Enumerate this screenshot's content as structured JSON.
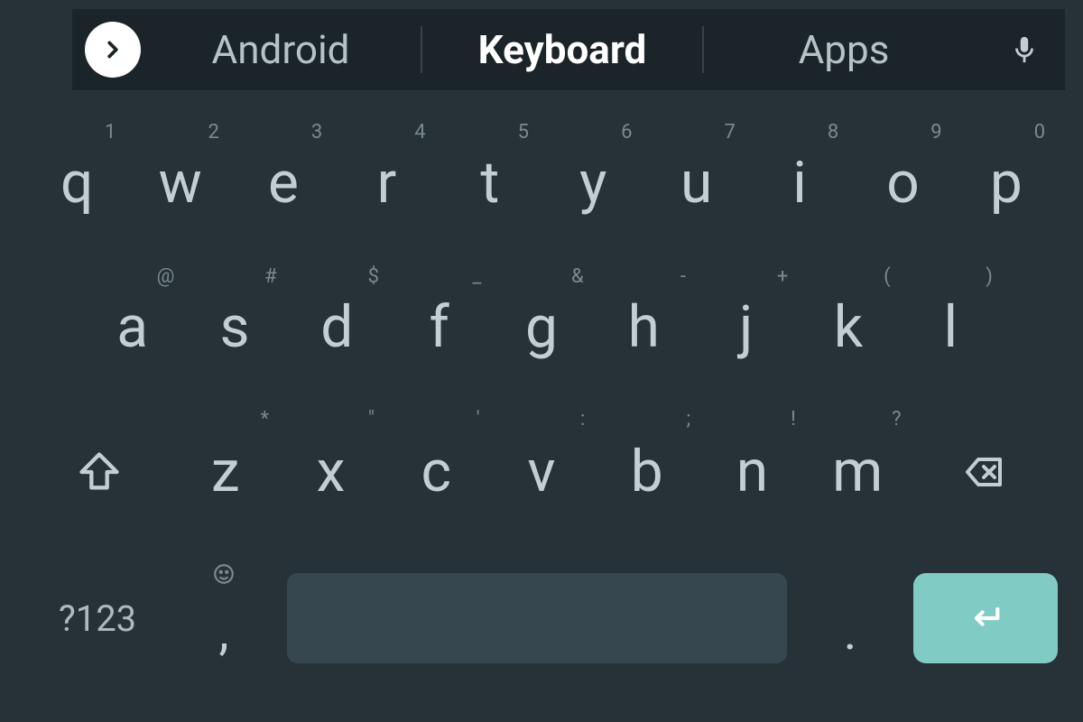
{
  "colors": {
    "bg": "#263238",
    "sugbar": "#1b2428",
    "text": "#c4cdd1",
    "hint": "#7b888d",
    "space": "#37474f",
    "enter": "#80cbc4"
  },
  "suggestions": {
    "items": [
      "Android",
      "Keyboard",
      "Apps"
    ],
    "center_index": 1,
    "expand_icon": "chevron-right",
    "voice_icon": "mic"
  },
  "rows": {
    "row1": [
      {
        "main": "q",
        "hint": "1"
      },
      {
        "main": "w",
        "hint": "2"
      },
      {
        "main": "e",
        "hint": "3"
      },
      {
        "main": "r",
        "hint": "4"
      },
      {
        "main": "t",
        "hint": "5"
      },
      {
        "main": "y",
        "hint": "6"
      },
      {
        "main": "u",
        "hint": "7"
      },
      {
        "main": "i",
        "hint": "8"
      },
      {
        "main": "o",
        "hint": "9"
      },
      {
        "main": "p",
        "hint": "0"
      }
    ],
    "row2": [
      {
        "main": "a",
        "hint": "@"
      },
      {
        "main": "s",
        "hint": "#"
      },
      {
        "main": "d",
        "hint": "$"
      },
      {
        "main": "f",
        "hint": "_"
      },
      {
        "main": "g",
        "hint": "&"
      },
      {
        "main": "h",
        "hint": "-"
      },
      {
        "main": "j",
        "hint": "+"
      },
      {
        "main": "k",
        "hint": "("
      },
      {
        "main": "l",
        "hint": ")"
      }
    ],
    "row3": [
      {
        "main": "z",
        "hint": "*"
      },
      {
        "main": "x",
        "hint": "\""
      },
      {
        "main": "c",
        "hint": "'"
      },
      {
        "main": "v",
        "hint": ":"
      },
      {
        "main": "b",
        "hint": ";"
      },
      {
        "main": "n",
        "hint": "!"
      },
      {
        "main": "m",
        "hint": "?"
      }
    ]
  },
  "bottom": {
    "symbols_label": "?123",
    "comma": ",",
    "period": ".",
    "comma_hint_icon": "emoji",
    "enter_icon": "enter-arrow"
  },
  "fn": {
    "shift_icon": "shift-up",
    "backspace_icon": "backspace"
  }
}
